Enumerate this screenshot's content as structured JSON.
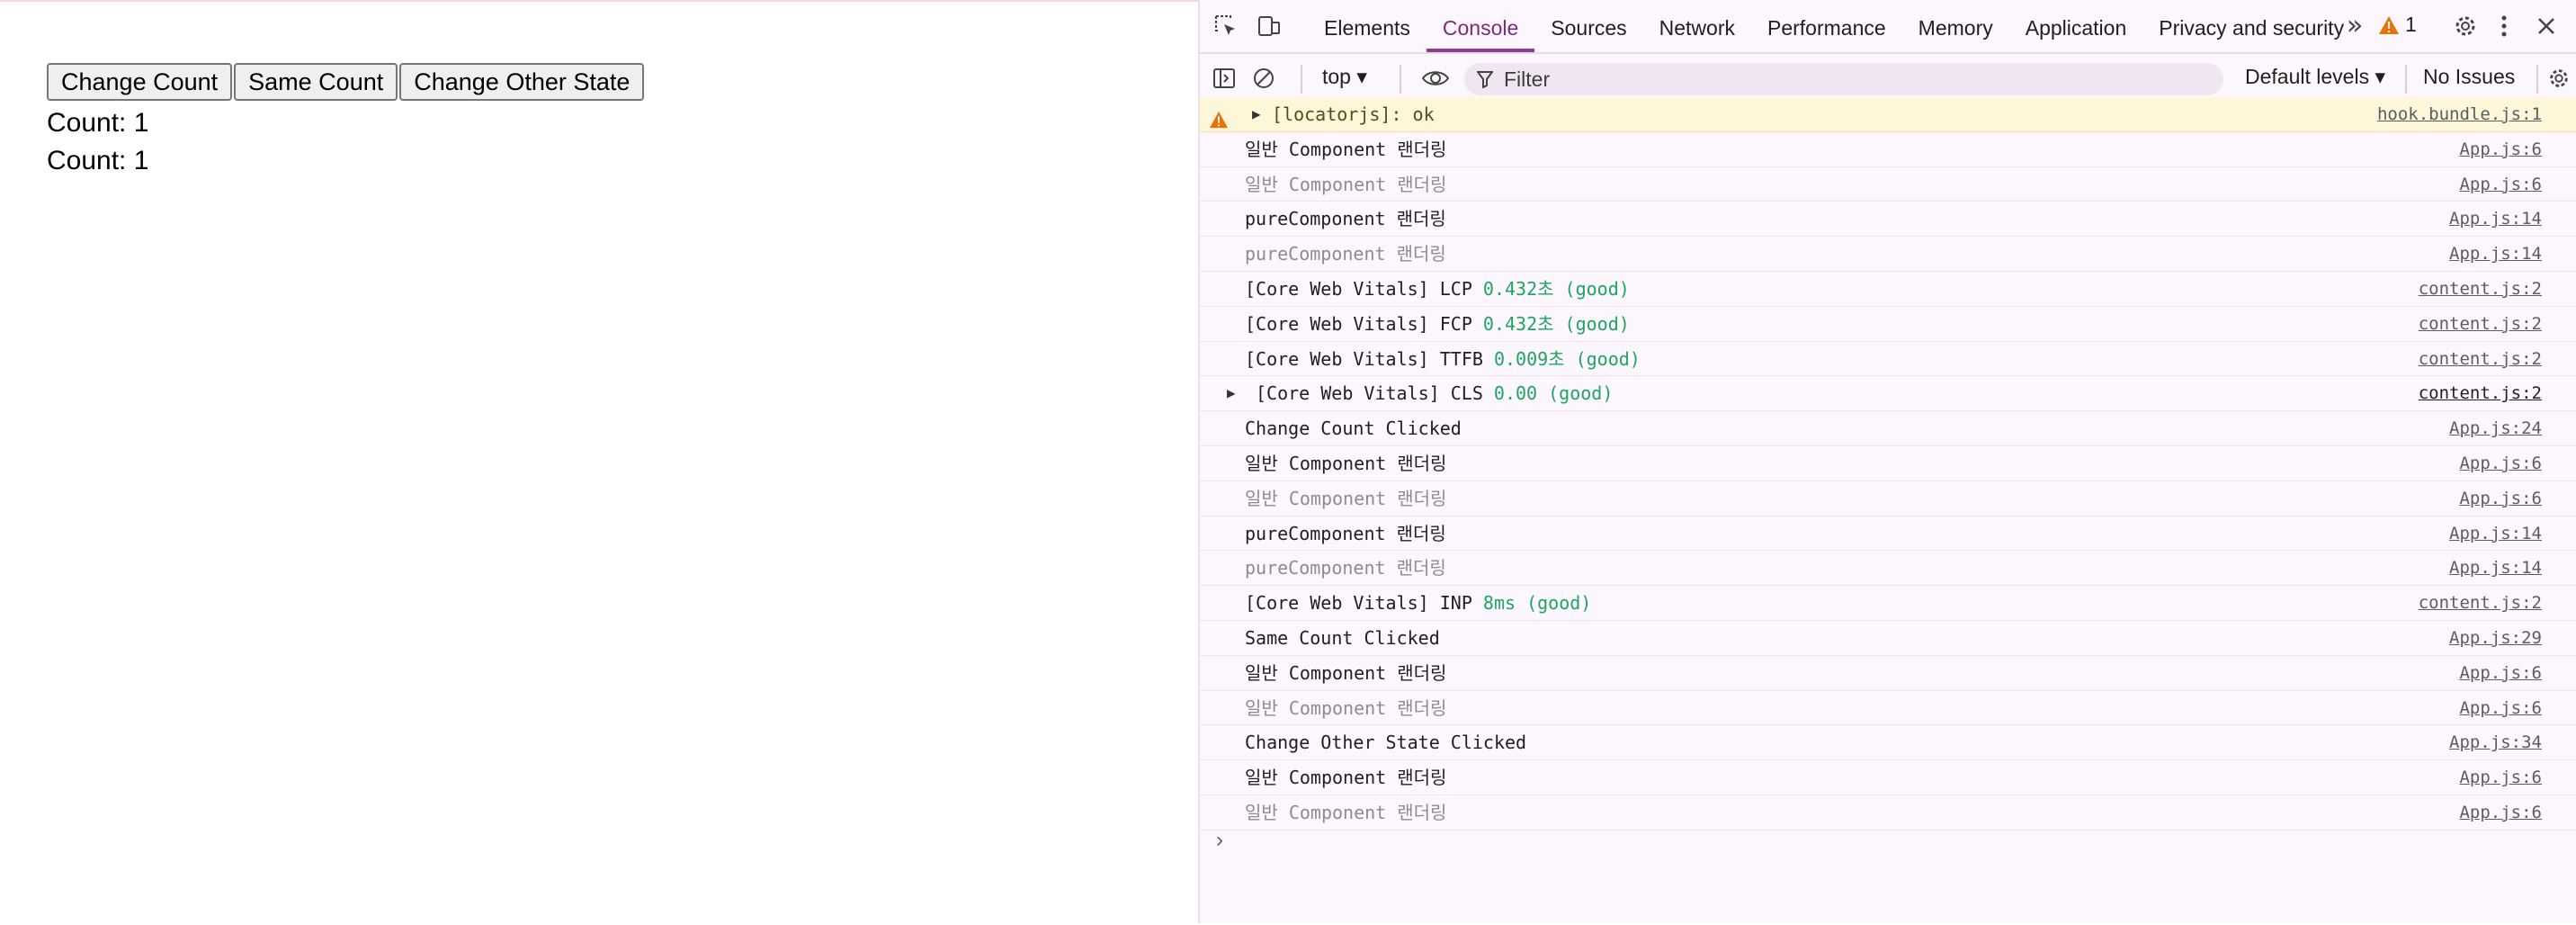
{
  "page": {
    "buttons": [
      "Change Count",
      "Same Count",
      "Change Other State"
    ],
    "counts": [
      "Count: 1",
      "Count: 1"
    ]
  },
  "devtools": {
    "tabs": [
      "Elements",
      "Console",
      "Sources",
      "Network",
      "Performance",
      "Memory",
      "Application",
      "Privacy and security"
    ],
    "active_tab": "Console",
    "more_glyph": "»",
    "warning_count": "1",
    "context": "top ▾",
    "filter_placeholder": "Filter",
    "levels": "Default levels ▾",
    "issues": "No Issues",
    "prompt": "›"
  },
  "console": [
    {
      "type": "warn",
      "expand": true,
      "text": "[locatorjs]: ok",
      "src": "hook.bundle.js:1"
    },
    {
      "type": "log",
      "text": "일반 Component 랜더링",
      "src": "App.js:6"
    },
    {
      "type": "dim",
      "text": "일반 Component 랜더링",
      "src": "App.js:6"
    },
    {
      "type": "log",
      "text": "pureComponent 랜더링",
      "src": "App.js:14"
    },
    {
      "type": "dim",
      "text": "pureComponent 랜더링",
      "src": "App.js:14"
    },
    {
      "type": "log",
      "text": "[Core Web Vitals] LCP ",
      "green": "0.432초 (good)",
      "src": "content.js:2"
    },
    {
      "type": "log",
      "text": "[Core Web Vitals] FCP ",
      "green": "0.432초 (good)",
      "src": "content.js:2"
    },
    {
      "type": "log",
      "text": "[Core Web Vitals] TTFB ",
      "green": "0.009초 (good)",
      "src": "content.js:2"
    },
    {
      "type": "cls",
      "expand": true,
      "text": "[Core Web Vitals] CLS ",
      "green": "0.00 (good)",
      "src": "content.js:2"
    },
    {
      "type": "log",
      "text": "Change Count Clicked",
      "src": "App.js:24"
    },
    {
      "type": "log",
      "text": "일반 Component 랜더링",
      "src": "App.js:6"
    },
    {
      "type": "dim",
      "text": "일반 Component 랜더링",
      "src": "App.js:6"
    },
    {
      "type": "log",
      "text": "pureComponent 랜더링",
      "src": "App.js:14"
    },
    {
      "type": "dim",
      "text": "pureComponent 랜더링",
      "src": "App.js:14"
    },
    {
      "type": "log",
      "text": "[Core Web Vitals] INP ",
      "green": "8ms (good)",
      "src": "content.js:2"
    },
    {
      "type": "log",
      "text": "Same Count Clicked",
      "src": "App.js:29"
    },
    {
      "type": "log",
      "text": "일반 Component 랜더링",
      "src": "App.js:6"
    },
    {
      "type": "dim",
      "text": "일반 Component 랜더링",
      "src": "App.js:6"
    },
    {
      "type": "log",
      "text": "Change Other State Clicked",
      "src": "App.js:34"
    },
    {
      "type": "log",
      "text": "일반 Component 랜더링",
      "src": "App.js:6"
    },
    {
      "type": "dim",
      "text": "일반 Component 랜더링",
      "src": "App.js:6"
    }
  ],
  "colors": {
    "accent": "#8a3d8a",
    "good": "#1fa463",
    "warning": "#e8710a",
    "warn_bg": "#fdf6d8"
  }
}
